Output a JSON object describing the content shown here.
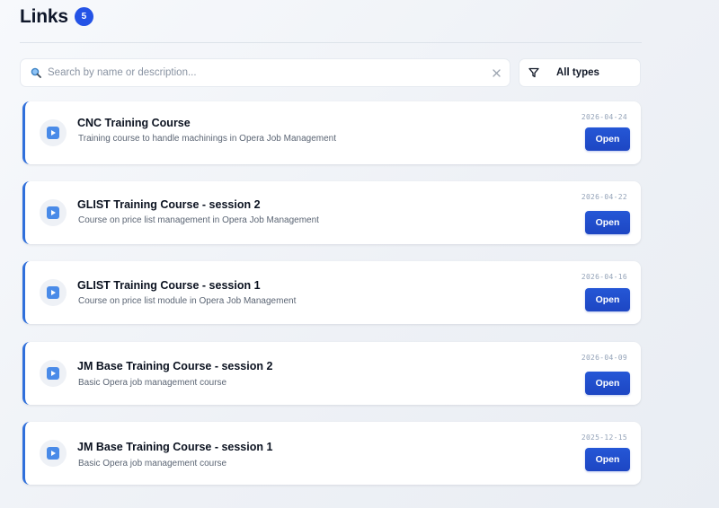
{
  "header": {
    "title": "Links",
    "count": "5"
  },
  "search": {
    "placeholder": "Search by name or description...",
    "value": "",
    "clear_icon": "close-icon",
    "search_icon": "magnifier-icon"
  },
  "filter": {
    "selected": "All types",
    "icon": "funnel-icon"
  },
  "links": [
    {
      "title": "CNC Training Course",
      "description": "Training course to handle machinings in Opera Job Management",
      "date": "2026-04-24",
      "button": "Open",
      "icon": "video-play-icon"
    },
    {
      "title": "GLIST Training Course - session 2",
      "description": "Course on price list management in Opera Job Management",
      "date": "2026-04-22",
      "button": "Open",
      "icon": "video-play-icon"
    },
    {
      "title": "GLIST Training Course - session 1",
      "description": "Course on price list module in Opera Job Management",
      "date": "2026-04-16",
      "button": "Open",
      "icon": "video-play-icon"
    },
    {
      "title": "JM Base Training Course - session 2",
      "description": "Basic Opera job management course",
      "date": "2026-04-09",
      "button": "Open",
      "icon": "video-play-icon"
    },
    {
      "title": "JM Base Training Course - session 1",
      "description": "Basic Opera job management course",
      "date": "2025-12-15",
      "button": "Open",
      "icon": "video-play-icon"
    }
  ],
  "colors": {
    "accent": "#2453e6",
    "card_border": "#2f6fdb",
    "button": "#1d46c3",
    "icon": "#4a8be8"
  }
}
